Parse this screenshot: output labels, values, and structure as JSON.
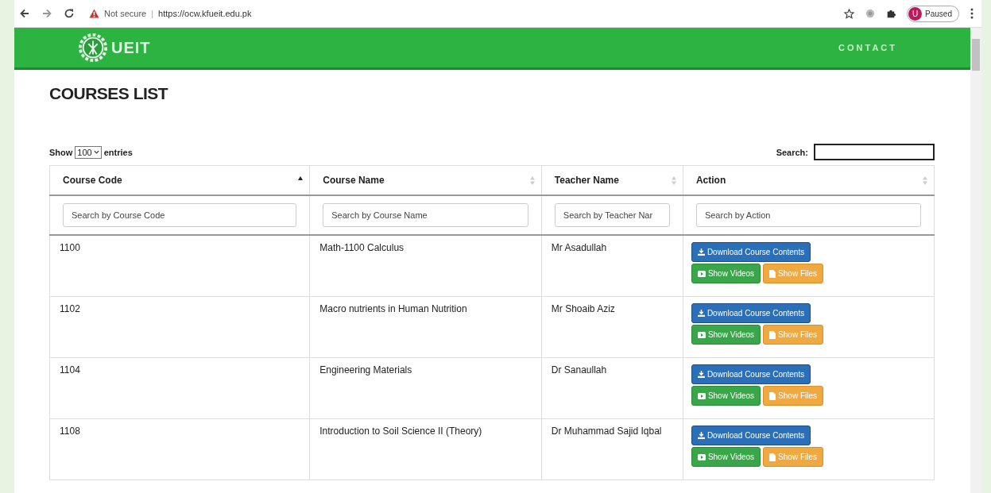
{
  "browser": {
    "security": "Not secure",
    "separator": "|",
    "url": "https://ocw.kfueit.edu.pk",
    "profile": {
      "initial": "U",
      "status": "Paused"
    }
  },
  "header": {
    "logo": "UEIT",
    "nav": [
      "CONTACT"
    ]
  },
  "title": "COURSES LIST",
  "length": {
    "before": "Show",
    "value": "100",
    "after": "entries"
  },
  "search": {
    "label": "Search:"
  },
  "table": {
    "columns": [
      {
        "label": "Course Code",
        "sorted": true,
        "placeholder": "Search by Course Code"
      },
      {
        "label": "Course Name",
        "sorted": false,
        "placeholder": "Search by Course Name"
      },
      {
        "label": "Teacher Name",
        "sorted": false,
        "placeholder": "Search by Teacher Nar"
      },
      {
        "label": "Action",
        "sorted": false,
        "placeholder": "Search by Action"
      }
    ],
    "rows": [
      {
        "code": "1100",
        "name": "Math-1100 Calculus",
        "teacher": "Mr Asadullah",
        "actions": [
          {
            "kind": "download",
            "label": "Download Course Contents"
          },
          {
            "kind": "videos",
            "label": "Show Videos"
          },
          {
            "kind": "files",
            "label": "Show Files"
          }
        ]
      },
      {
        "code": "1102",
        "name": "Macro nutrients in Human Nutrition",
        "teacher": "Mr Shoaib Aziz",
        "actions": [
          {
            "kind": "download",
            "label": "Download Course Contents"
          },
          {
            "kind": "videos",
            "label": "Show Videos"
          },
          {
            "kind": "files",
            "label": "Show Files"
          }
        ]
      },
      {
        "code": "1104",
        "name": "Engineering Materials",
        "teacher": "Dr Sanaullah",
        "actions": [
          {
            "kind": "download",
            "label": "Download Course Contents"
          },
          {
            "kind": "videos",
            "label": "Show Videos"
          },
          {
            "kind": "files",
            "label": "Show Files"
          }
        ]
      },
      {
        "code": "1108",
        "name": "Introduction to Soil Science II (Theory)",
        "teacher": "Dr Muhammad Sajid Iqbal",
        "actions": [
          {
            "kind": "download",
            "label": "Download Course Contents"
          },
          {
            "kind": "videos",
            "label": "Show Videos"
          },
          {
            "kind": "files",
            "label": "Show Files"
          }
        ]
      }
    ]
  }
}
